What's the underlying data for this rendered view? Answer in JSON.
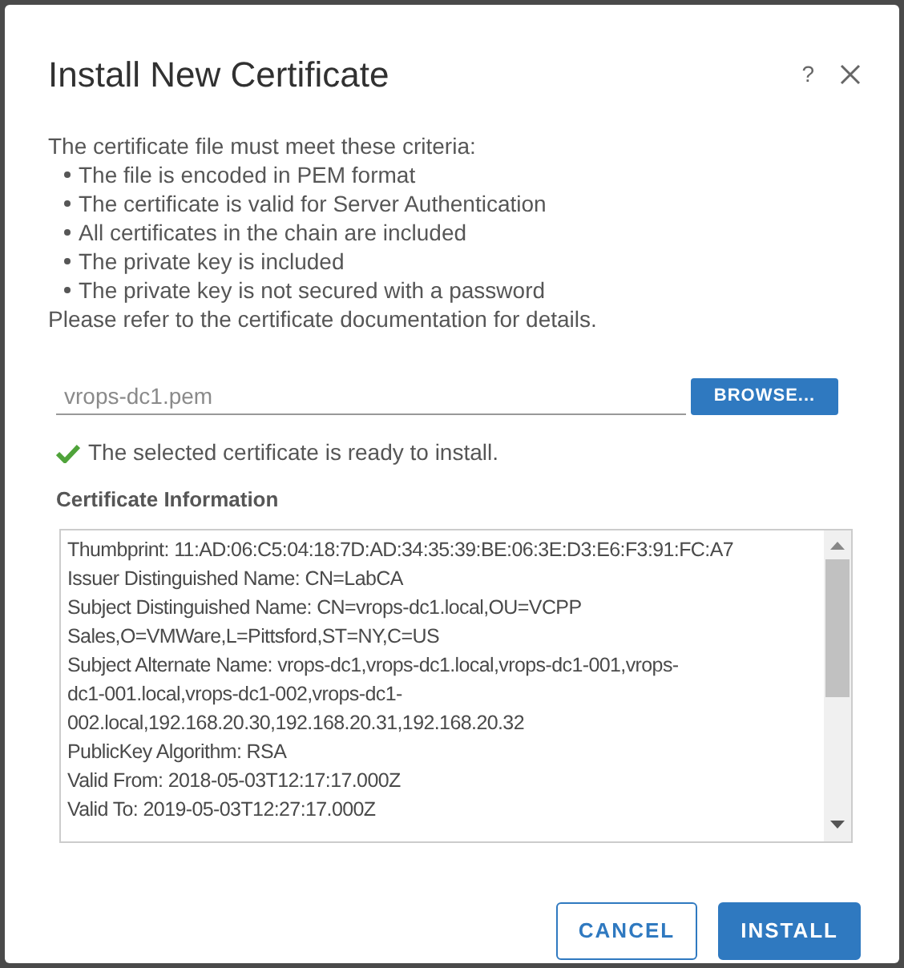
{
  "dialog": {
    "title": "Install New Certificate",
    "help": "?"
  },
  "criteria": {
    "intro": "The certificate file must meet these criteria:",
    "bullets": [
      "The file is encoded in PEM format",
      "The certificate is valid for Server Authentication",
      "All certificates in the chain are included",
      "The private key is included",
      "The private key is not secured with a password"
    ],
    "outro": "Please refer to the certificate documentation for details."
  },
  "file": {
    "value": "vrops-dc1.pem",
    "button": "BROWSE..."
  },
  "status": {
    "kind": "success",
    "message": "The selected certificate is ready to install."
  },
  "certificate_info": {
    "label": "Certificate Information",
    "lines": [
      "Thumbprint: 11:AD:06:C5:04:18:7D:AD:34:35:39:BE:06:3E:D3:E6:F3:91:FC:A7",
      "Issuer Distinguished Name: CN=LabCA",
      "Subject Distinguished Name: CN=vrops-dc1.local,OU=VCPP",
      "Sales,O=VMWare,L=Pittsford,ST=NY,C=US",
      "Subject Alternate Name: vrops-dc1,vrops-dc1.local,vrops-dc1-001,vrops-",
      "dc1-001.local,vrops-dc1-002,vrops-dc1-",
      "002.local,192.168.20.30,192.168.20.31,192.168.20.32",
      "PublicKey Algorithm: RSA",
      "Valid From: 2018-05-03T12:17:17.000Z",
      "Valid To: 2019-05-03T12:27:17.000Z"
    ]
  },
  "buttons": [
    {
      "label": "CANCEL",
      "kind": "secondary"
    },
    {
      "label": "INSTALL",
      "kind": "primary"
    }
  ]
}
